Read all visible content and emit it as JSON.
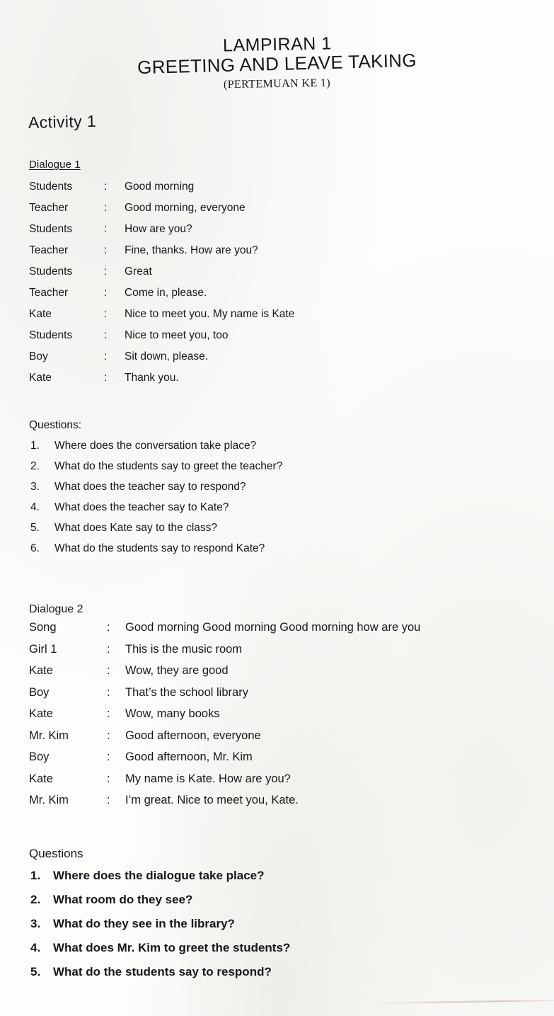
{
  "document": {
    "title_line_1": "LAMPIRAN 1",
    "title_line_2": "GREETING AND LEAVE TAKING",
    "title_subtitle": "(PERTEMUAN KE 1)",
    "activity_heading": "Activity 1"
  },
  "dialogue_1": {
    "heading": "Dialogue 1",
    "separator": ":",
    "lines": [
      {
        "speaker": "Students",
        "text": "Good morning"
      },
      {
        "speaker": "Teacher",
        "text": "Good morning, everyone"
      },
      {
        "speaker": "Students",
        "text": "How are you?"
      },
      {
        "speaker": "Teacher",
        "text": "Fine, thanks. How are you?"
      },
      {
        "speaker": "Students",
        "text": "Great"
      },
      {
        "speaker": "Teacher",
        "text": "Come in, please."
      },
      {
        "speaker": "Kate",
        "text": "Nice to meet you. My name is Kate"
      },
      {
        "speaker": "Students",
        "text": "Nice to meet you, too"
      },
      {
        "speaker": "Boy",
        "text": "Sit down, please."
      },
      {
        "speaker": "Kate",
        "text": "Thank you."
      }
    ]
  },
  "questions_1": {
    "label": "Questions:",
    "items": [
      {
        "number": "1.",
        "text": "Where does the conversation take place?"
      },
      {
        "number": "2.",
        "text": "What do the students say to greet the teacher?"
      },
      {
        "number": "3.",
        "text": "What does the teacher say to respond?"
      },
      {
        "number": "4.",
        "text": "What does the teacher say to Kate?"
      },
      {
        "number": "5.",
        "text": "What does Kate say to the class?"
      },
      {
        "number": "6.",
        "text": "What do the students say to respond Kate?"
      }
    ]
  },
  "dialogue_2": {
    "heading": "Dialogue 2",
    "separator": ":",
    "lines": [
      {
        "speaker": "Song",
        "text": "Good morning Good morning Good morning how are you"
      },
      {
        "speaker": "Girl 1",
        "text": "This is the music room"
      },
      {
        "speaker": "Kate",
        "text": "Wow,  they are good"
      },
      {
        "speaker": "Boy",
        "text": "That’s the school library"
      },
      {
        "speaker": "Kate",
        "text": "Wow, many books"
      },
      {
        "speaker": "Mr. Kim",
        "text": "Good afternoon, everyone"
      },
      {
        "speaker": "Boy",
        "text": "Good afternoon, Mr. Kim"
      },
      {
        "speaker": "Kate",
        "text": "My name is Kate. How are you?"
      },
      {
        "speaker": "Mr. Kim",
        "text": "I’m great. Nice to meet you, Kate."
      }
    ]
  },
  "questions_2": {
    "label": "Questions",
    "items": [
      {
        "number": "1.",
        "text": "Where does the dialogue take place?"
      },
      {
        "number": "2.",
        "text": "What room do they see?"
      },
      {
        "number": "3.",
        "text": "What do they see in the library?"
      },
      {
        "number": "4.",
        "text": "What does Mr. Kim to greet the students?"
      },
      {
        "number": "5.",
        "text": "What do the students say to respond?"
      }
    ]
  }
}
